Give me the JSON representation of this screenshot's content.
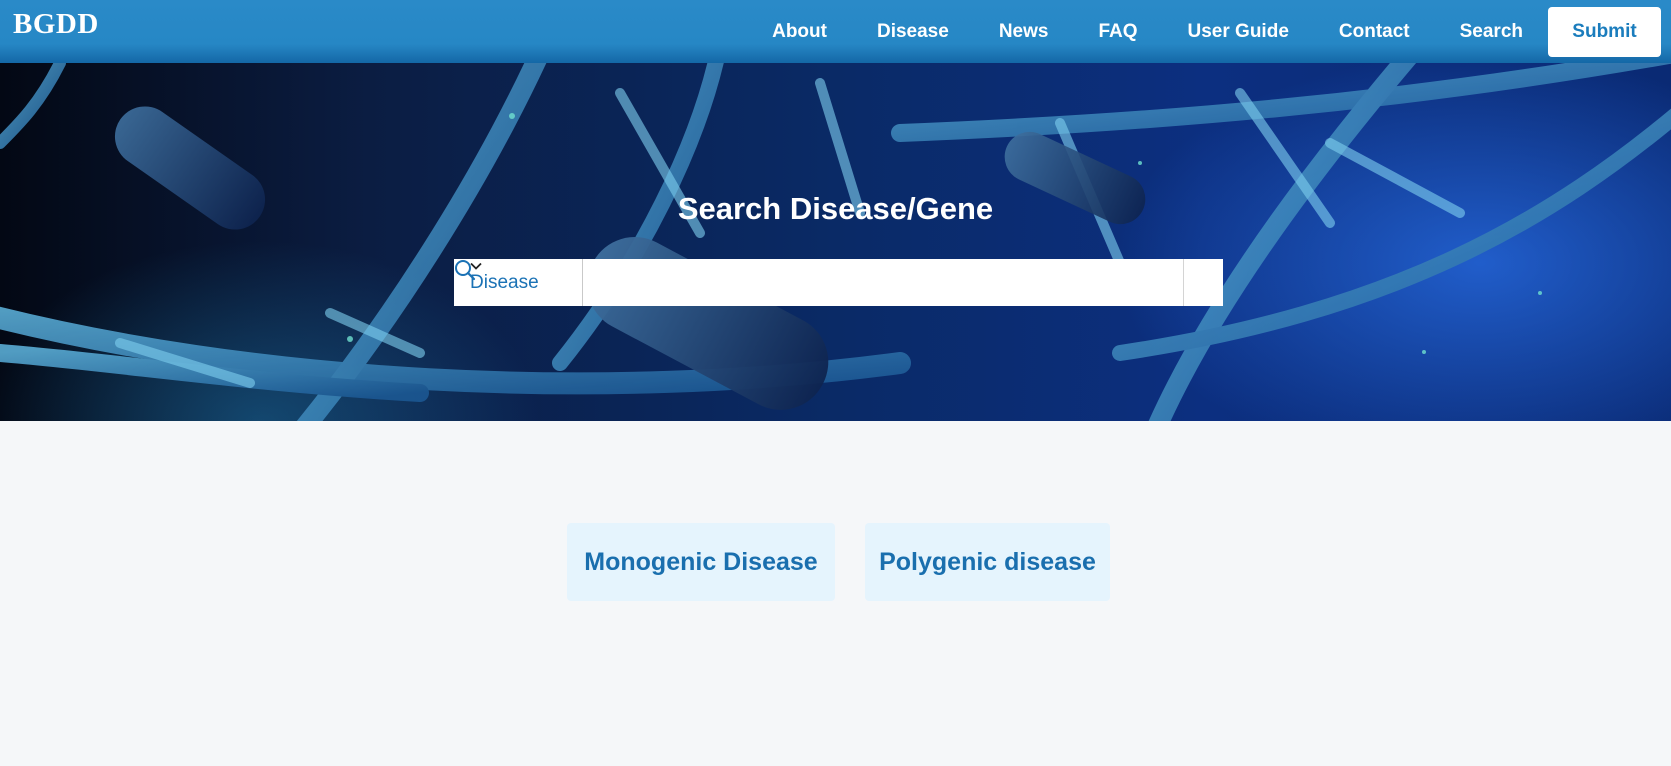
{
  "header": {
    "logo": "BGDD",
    "nav": [
      {
        "label": "About"
      },
      {
        "label": "Disease"
      },
      {
        "label": "News"
      },
      {
        "label": "FAQ"
      },
      {
        "label": "User Guide"
      },
      {
        "label": "Contact"
      },
      {
        "label": "Search"
      }
    ],
    "submit_label": "Submit"
  },
  "hero": {
    "title": "Search Disease/Gene",
    "search": {
      "select_value": "Disease",
      "input_value": "",
      "input_placeholder": "",
      "select_icon": "chevron-down-icon",
      "button_icon": "search-icon"
    }
  },
  "cards": [
    {
      "label": "Monogenic Disease"
    },
    {
      "label": "Polygenic disease"
    }
  ],
  "colors": {
    "header_bg": "#2687c5",
    "accent_text": "#1a6fae",
    "card_bg": "#e5f4fd",
    "page_bg": "#f5f7f9"
  }
}
